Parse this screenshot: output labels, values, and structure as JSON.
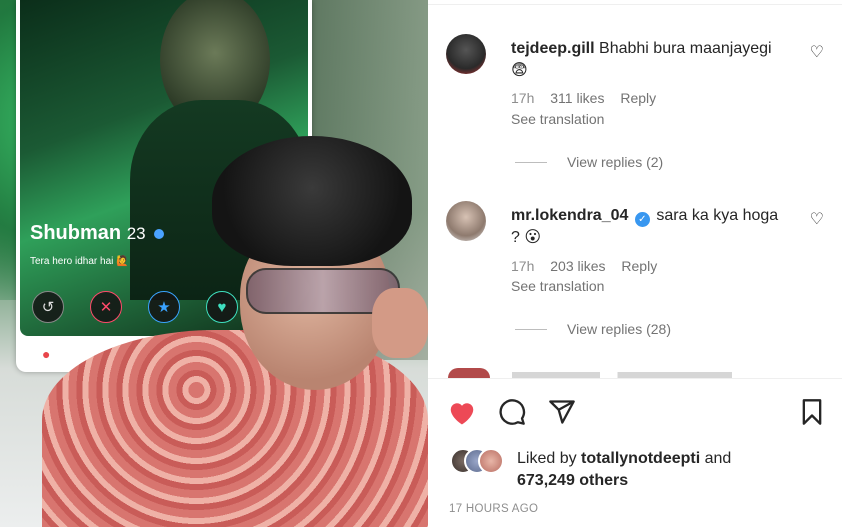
{
  "post_image": {
    "profile_card": {
      "name": "Shubman",
      "age": "23",
      "tagline": "Tera hero idhar hai 🙋"
    }
  },
  "comments": [
    {
      "username": "tejdeep.gill",
      "text": "Bhabhi bura maanjayegi",
      "emoji": "😨",
      "time": "17h",
      "likes": "311 likes",
      "reply_label": "Reply",
      "see_translation": "See translation",
      "view_replies": "View replies (2)"
    },
    {
      "username": "mr.lokendra_04",
      "text": "sara ka kya hoga",
      "text2": "?",
      "emoji": "😮",
      "time": "17h",
      "likes": "203 likes",
      "reply_label": "Reply",
      "see_translation": "See translation",
      "view_replies": "View replies (28)"
    }
  ],
  "actions": {
    "like_icon": "heart-filled-icon",
    "comment_icon": "comment-icon",
    "share_icon": "share-icon",
    "save_icon": "bookmark-icon",
    "like_color": "#ed4956"
  },
  "likes_summary": {
    "prefix": "Liked by",
    "user": "totallynotdeepti",
    "connector": "and",
    "others": "673,249 others"
  },
  "timestamp": "17 HOURS AGO"
}
